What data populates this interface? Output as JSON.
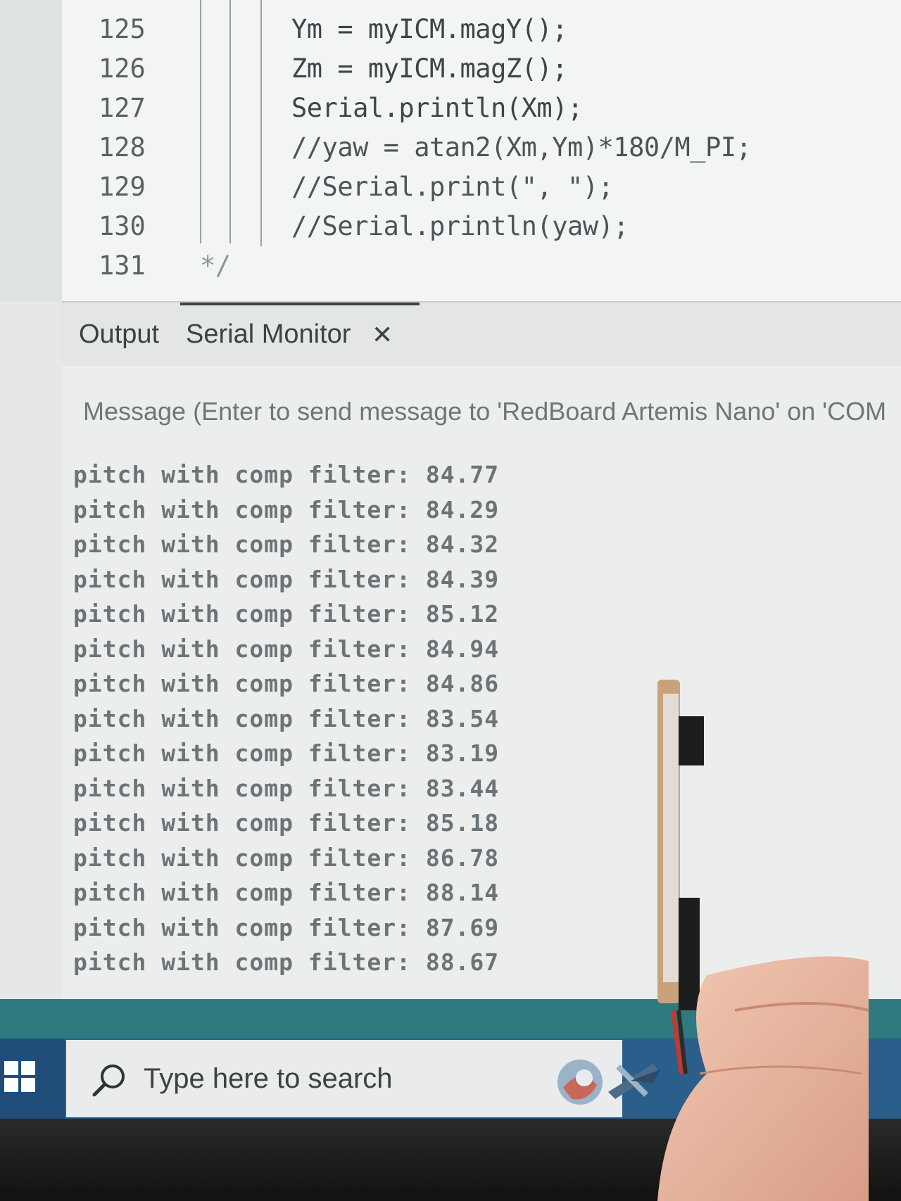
{
  "editor": {
    "lines": [
      {
        "num": "125",
        "code": "Ym = myICM.magY();"
      },
      {
        "num": "126",
        "code": "Zm = myICM.magZ();"
      },
      {
        "num": "127",
        "code": "Serial.println(Xm);"
      },
      {
        "num": "128",
        "code": "//yaw = atan2(Xm,Ym)*180/M_PI;"
      },
      {
        "num": "129",
        "code": "//Serial.print(\", \");"
      },
      {
        "num": "130",
        "code": "//Serial.println(yaw);"
      },
      {
        "num": "131",
        "code": "*/"
      }
    ]
  },
  "panel": {
    "tabs": [
      {
        "label": "Output"
      },
      {
        "label": "Serial Monitor"
      }
    ],
    "active_tab": "Serial Monitor"
  },
  "serial_monitor": {
    "placeholder": "Message (Enter to send message to 'RedBoard Artemis Nano' on 'COM",
    "lines": [
      "pitch with comp filter: 84.77",
      "pitch with comp filter: 84.29",
      "pitch with comp filter: 84.32",
      "pitch with comp filter: 84.39",
      "pitch with comp filter: 85.12",
      "pitch with comp filter: 84.94",
      "pitch with comp filter: 84.86",
      "pitch with comp filter: 83.54",
      "pitch with comp filter: 83.19",
      "pitch with comp filter: 83.44",
      "pitch with comp filter: 85.18",
      "pitch with comp filter: 86.78",
      "pitch with comp filter: 88.14",
      "pitch with comp filter: 87.69",
      "pitch with comp filter: 88.67"
    ]
  },
  "taskbar": {
    "search_placeholder": "Type here to search",
    "start_icon": "windows-logo-icon",
    "search_icon": "search-icon"
  },
  "colors": {
    "taskbar": "#2b5e8a",
    "status_strip": "#2e7a7e",
    "monitor_bg": "#eceeee",
    "serial_text": "#6c7477"
  }
}
